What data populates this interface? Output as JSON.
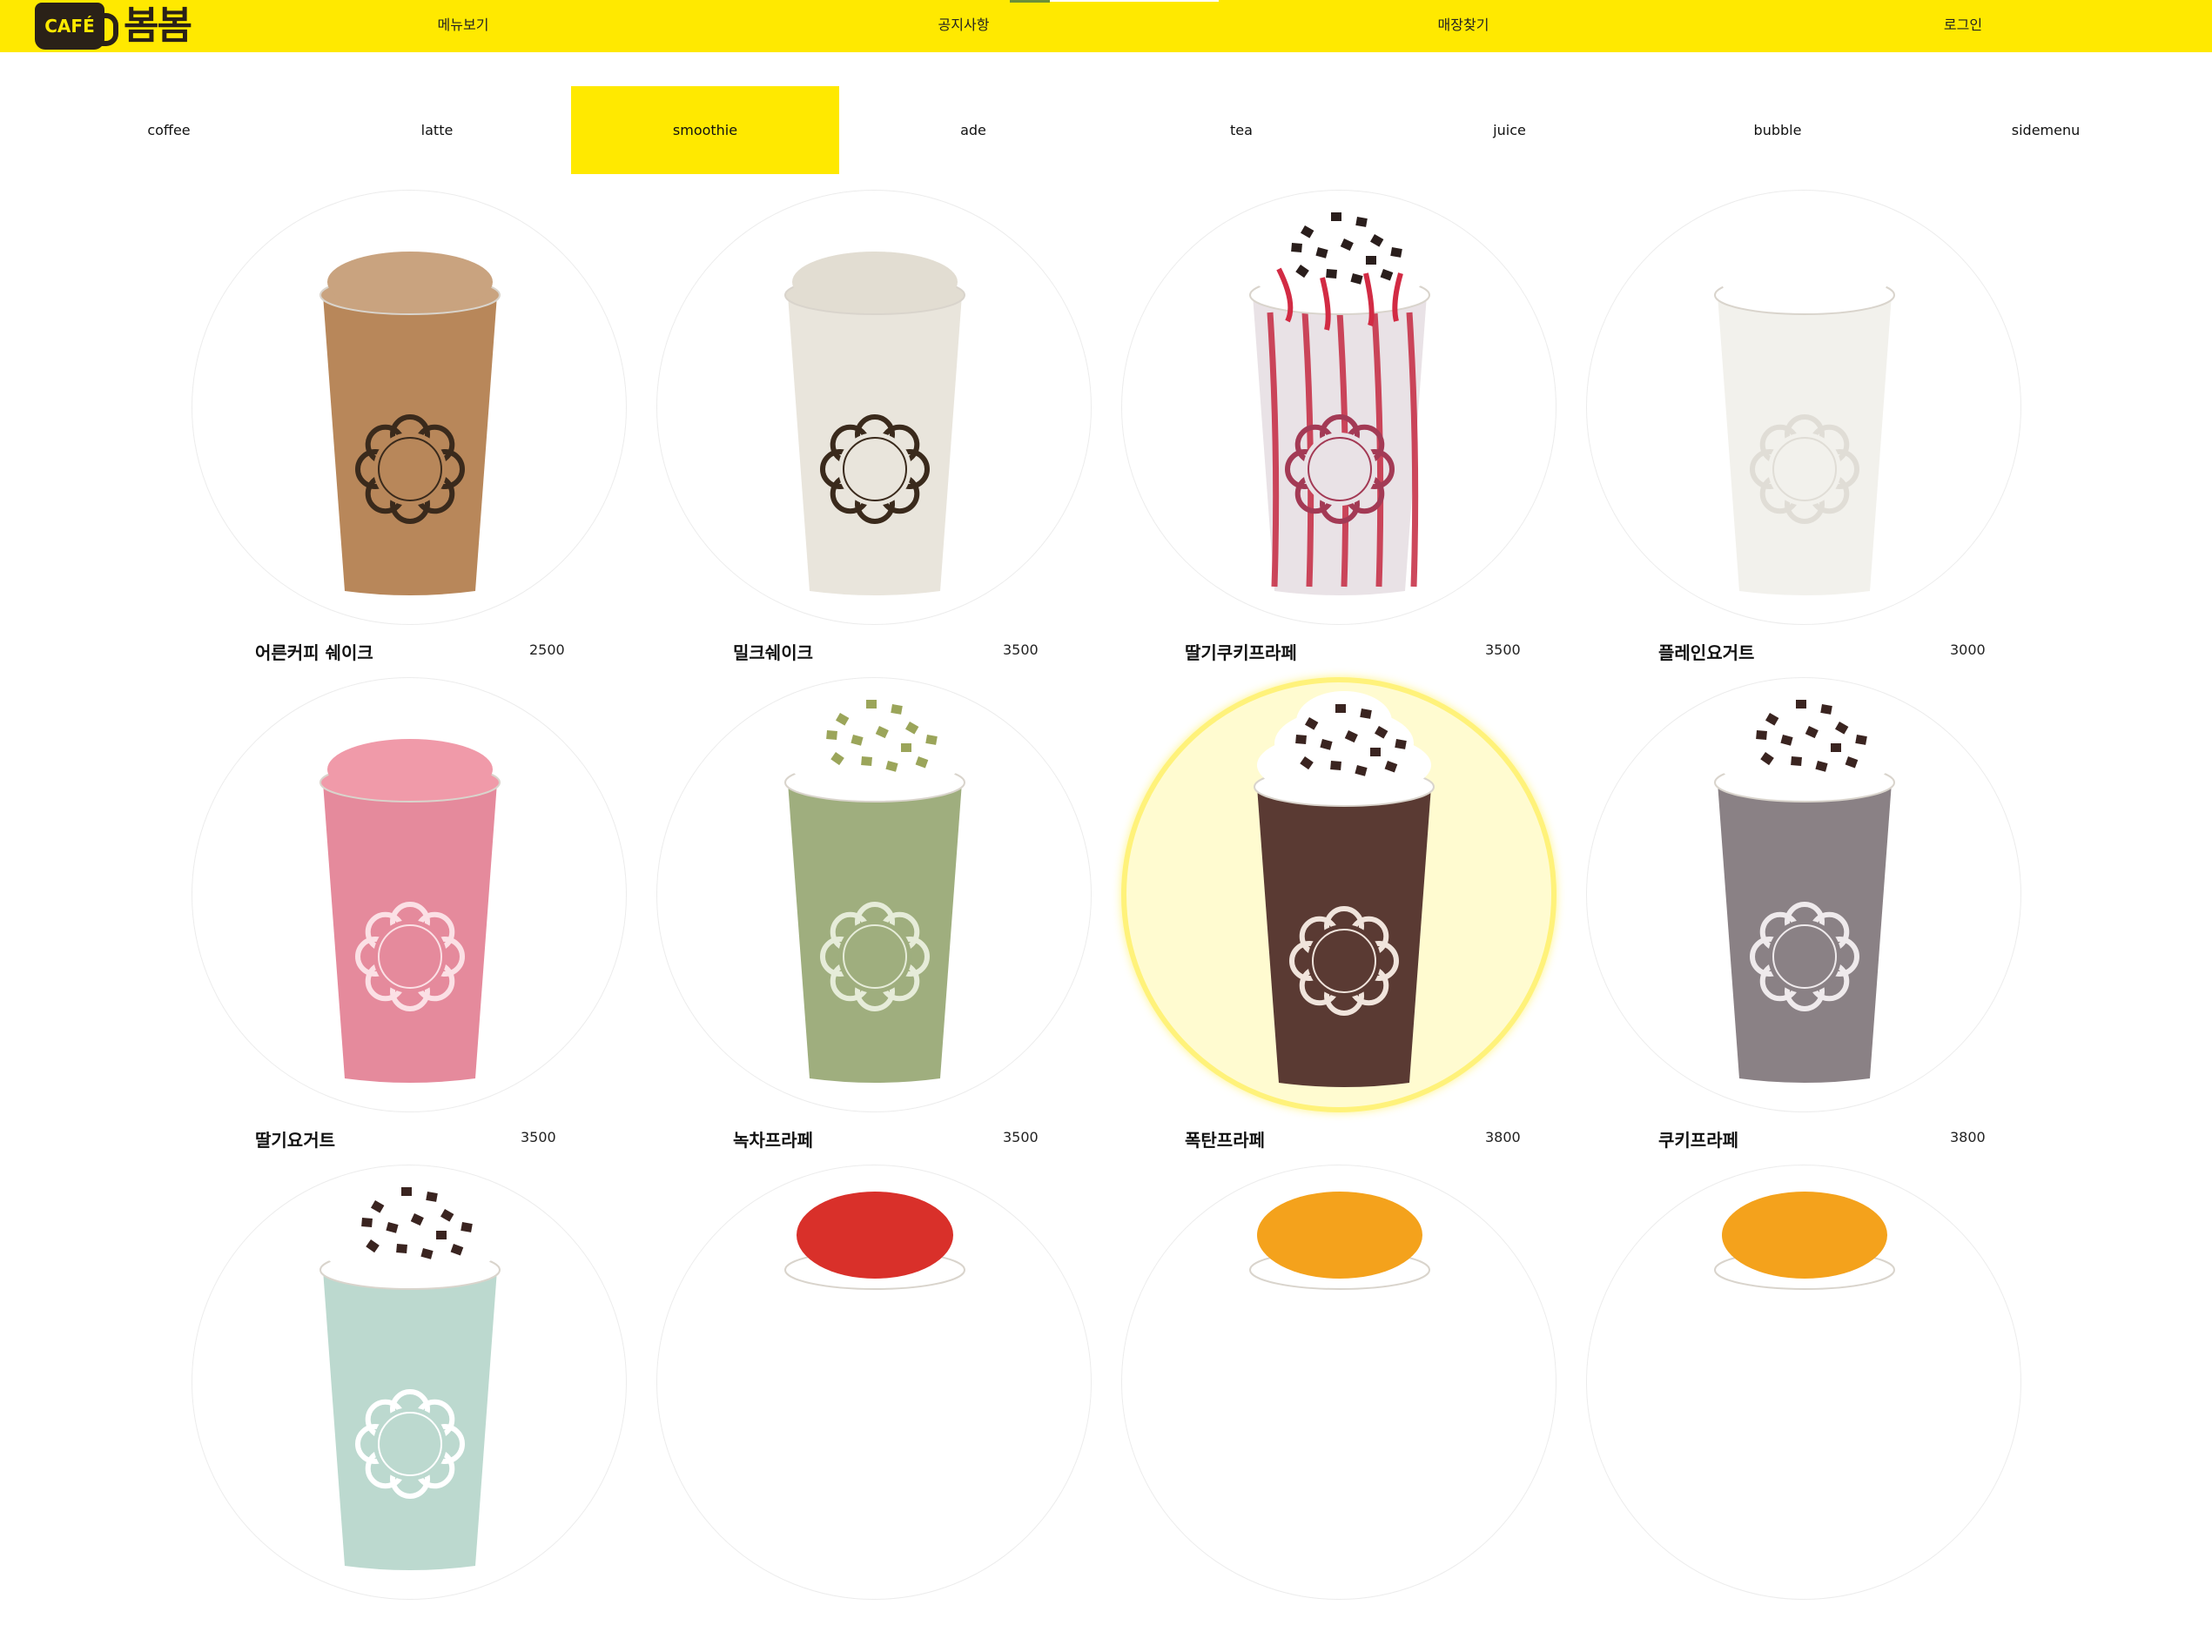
{
  "header": {
    "logo_cafe": "CAFÉ",
    "logo_name": "봄봄",
    "nav": [
      {
        "label": "메뉴보기"
      },
      {
        "label": "공지사항"
      },
      {
        "label": "매장찾기"
      },
      {
        "label": "로그인"
      }
    ]
  },
  "tabs": [
    {
      "label": "coffee"
    },
    {
      "label": "latte"
    },
    {
      "label": "smoothie",
      "active": true
    },
    {
      "label": "ade"
    },
    {
      "label": "tea"
    },
    {
      "label": "juice"
    },
    {
      "label": "bubble"
    },
    {
      "label": "sidemenu"
    }
  ],
  "menu": [
    {
      "name": "어른커피 쉐이크",
      "price": "2500"
    },
    {
      "name": "밀크쉐이크",
      "price": "3500"
    },
    {
      "name": "딸기쿠키프라페",
      "price": "3500"
    },
    {
      "name": "플레인요거트",
      "price": "3000"
    },
    {
      "name": "딸기요거트",
      "price": "3500"
    },
    {
      "name": "녹차프라페",
      "price": "3500"
    },
    {
      "name": "폭탄프라페",
      "price": "3800"
    },
    {
      "name": "쿠키프라페",
      "price": "3800"
    },
    {
      "name": "",
      "price": ""
    },
    {
      "name": "",
      "price": ""
    },
    {
      "name": "",
      "price": ""
    },
    {
      "name": "",
      "price": ""
    }
  ],
  "colors": {
    "brand_yellow": "#ffe900",
    "logo_dark": "#2a2118",
    "highlight_disc": "#fffbd0"
  }
}
